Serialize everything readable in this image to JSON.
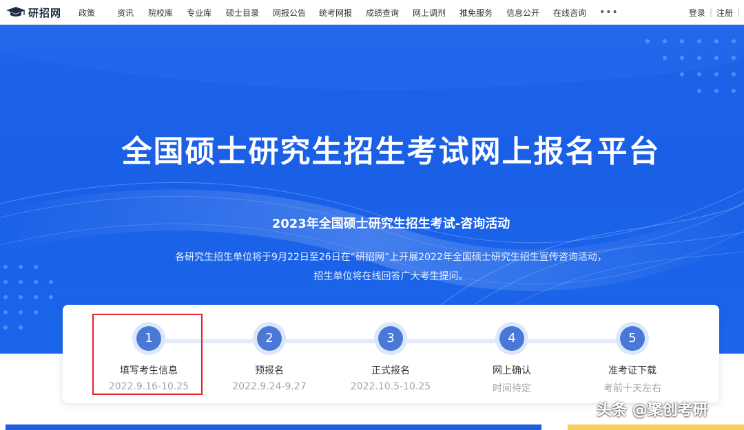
{
  "header": {
    "logo_text": "研招网",
    "nav": [
      "政策",
      "资讯",
      "院校库",
      "专业库",
      "硕士目录",
      "网报公告",
      "统考网报",
      "成绩查询",
      "网上调剂",
      "推免服务",
      "信息公开",
      "在线咨询"
    ],
    "more": "•••",
    "login": "登录",
    "sep": "|",
    "register": "注册"
  },
  "hero": {
    "title": "全国硕士研究生招生考试网上报名平台",
    "subtitle": "2023年全国硕士研究生招生考试-咨询活动",
    "desc_line1": "各研究生招生单位将于9月22日至26日在“研招网”上开展2022年全国硕士研究生招生宣传咨询活动，",
    "desc_line2": "招生单位将在线回答广大考生提问。"
  },
  "steps": [
    {
      "num": "1",
      "name": "填写考生信息",
      "date": "2022.9.16-10.25"
    },
    {
      "num": "2",
      "name": "预报名",
      "date": "2022.9.24-9.27"
    },
    {
      "num": "3",
      "name": "正式报名",
      "date": "2022.10.5-10.25"
    },
    {
      "num": "4",
      "name": "网上确认",
      "date": "时间待定"
    },
    {
      "num": "5",
      "name": "准考证下载",
      "date": "考前十天左右"
    }
  ],
  "watermark": "头条 @聚创考研",
  "colors": {
    "hero_blue": "#1e63e8",
    "step_blue": "#4a78d6",
    "highlight_red": "#e8202a",
    "accent_yellow": "#f5cf59"
  }
}
